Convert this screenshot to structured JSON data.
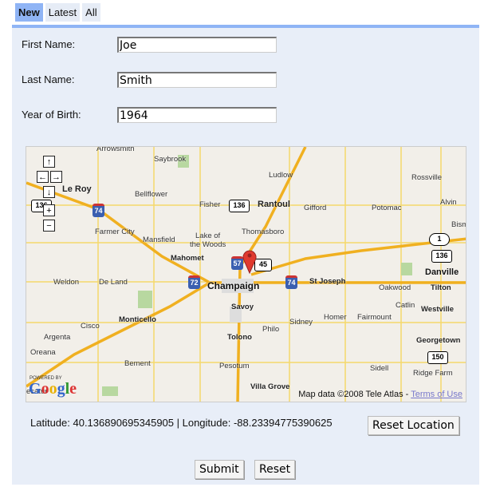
{
  "tabs": [
    {
      "label": "New",
      "active": true
    },
    {
      "label": "Latest"
    },
    {
      "label": "All"
    }
  ],
  "form": {
    "first_name": {
      "label": "First Name:",
      "value": "Joe"
    },
    "last_name": {
      "label": "Last Name:",
      "value": "Smith"
    },
    "year_of_birth": {
      "label": "Year of Birth:",
      "value": "1964"
    }
  },
  "map": {
    "places": [
      "Arrowsmith",
      "Saybrook",
      "Ludlow",
      "Rossville",
      "Le Roy",
      "Bellflower",
      "Fisher",
      "Rantoul",
      "Gifford",
      "Potomac",
      "Alvin",
      "Bism",
      "Farmer City",
      "Mansfield",
      "Lake of",
      "the Woods",
      "Thomasboro",
      "Mahomet",
      "Champaign",
      "St Joseph",
      "Danville",
      "Weldon",
      "De Land",
      "Oakwood",
      "Tilton",
      "Savoy",
      "Catlin",
      "Westville",
      "Monticello",
      "Philo",
      "Sidney",
      "Homer",
      "Fairmount",
      "Cisco",
      "Argenta",
      "Tolono",
      "Georgetown",
      "Oreana",
      "Bement",
      "Sidell",
      "Pesotum",
      "Ridge Farm",
      "Villa Grove",
      "ecatur"
    ],
    "shields": [
      "136",
      "74",
      "57",
      "45",
      "72",
      "74",
      "1",
      "136",
      "150",
      "136"
    ],
    "controls": [
      "↑",
      "←",
      "→",
      "↓",
      "+",
      "−"
    ],
    "powered_by": "POWERED BY",
    "logo": "Google",
    "copyright": "Map data ©2008 Tele Atlas - ",
    "terms": "Terms of Use",
    "marker_color": "#e03a2f"
  },
  "location": {
    "text": "Latitude: 40.136890695345905 | Longitude: -88.23394775390625",
    "reset_label": "Reset Location"
  },
  "actions": {
    "submit": "Submit",
    "reset": "Reset"
  },
  "colors": {
    "tab_active": "#8fb4f5",
    "panel": "#e8eef8"
  }
}
